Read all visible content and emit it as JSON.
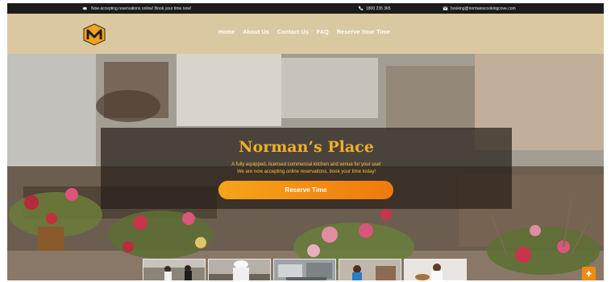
{
  "topbar": {
    "announcement": "Now accepting reservations online! Book your time now!",
    "phone": "1800 235 365",
    "email": "booking@normanscookingcove.com"
  },
  "header": {
    "logo_text": "NM",
    "nav": [
      "Home",
      "About Us",
      "Contact Us",
      "FAQ",
      "Reserve Your Time"
    ]
  },
  "hero": {
    "title": "Norman’s Place",
    "line1": "A fully equipped, licensed commercial kitchen and venue for your use!",
    "line2": "We are now accepting online reservations, book your time today!",
    "button_label": "Reserve Time"
  },
  "colors": {
    "accent": "#f28a12",
    "title": "#f0b02a",
    "header_bg": "#dac9a0",
    "topbar_bg": "#1b1b1b"
  },
  "icons": {
    "announce": "megaphone-icon",
    "phone": "phone-icon",
    "email": "envelope-icon",
    "scroll_top": "arrow-up-icon"
  }
}
